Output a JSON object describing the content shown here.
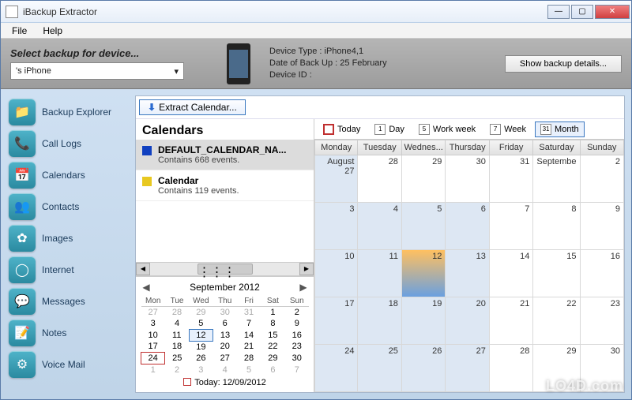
{
  "window": {
    "title": "iBackup Extractor"
  },
  "winbuttons": {
    "min": "—",
    "max": "▢",
    "close": "✕"
  },
  "menu": {
    "file": "File",
    "help": "Help"
  },
  "toolbar": {
    "select_label": "Select backup for device...",
    "dropdown_value": "'s iPhone",
    "device_type_label": "Device Type :",
    "device_type_value": "iPhone4,1",
    "backup_date_label": "Date of Back Up :",
    "backup_date_value": "25 February",
    "device_id_label": "Device ID :",
    "device_id_value": "",
    "show_details": "Show backup details..."
  },
  "sidebar": {
    "items": [
      {
        "label": "Backup Explorer",
        "icon": "📁"
      },
      {
        "label": "Call Logs",
        "icon": "📞"
      },
      {
        "label": "Calendars",
        "icon": "📅"
      },
      {
        "label": "Contacts",
        "icon": "👥"
      },
      {
        "label": "Images",
        "icon": "✿"
      },
      {
        "label": "Internet",
        "icon": "◯"
      },
      {
        "label": "Messages",
        "icon": "💬"
      },
      {
        "label": "Notes",
        "icon": "📝"
      },
      {
        "label": "Voice Mail",
        "icon": "⚙"
      }
    ]
  },
  "extract": {
    "label": "Extract Calendar...",
    "arrow": "⬇"
  },
  "calendars": {
    "heading": "Calendars",
    "list": [
      {
        "name": "DEFAULT_CALENDAR_NA...",
        "sub": "Contains 668 events.",
        "color": "#1040c0",
        "selected": true
      },
      {
        "name": "Calendar",
        "sub": "Contains 119 events.",
        "color": "#e8c820",
        "selected": false
      }
    ]
  },
  "minical": {
    "prev": "◀",
    "next": "▶",
    "title": "September 2012",
    "dow": [
      "Mon",
      "Tue",
      "Wed",
      "Thu",
      "Fri",
      "Sat",
      "Sun"
    ],
    "weeks": [
      [
        {
          "d": "27",
          "o": true
        },
        {
          "d": "28",
          "o": true
        },
        {
          "d": "29",
          "o": true
        },
        {
          "d": "30",
          "o": true
        },
        {
          "d": "31",
          "o": true
        },
        {
          "d": "1"
        },
        {
          "d": "2"
        }
      ],
      [
        {
          "d": "3"
        },
        {
          "d": "4"
        },
        {
          "d": "5"
        },
        {
          "d": "6"
        },
        {
          "d": "7"
        },
        {
          "d": "8"
        },
        {
          "d": "9"
        }
      ],
      [
        {
          "d": "10"
        },
        {
          "d": "11"
        },
        {
          "d": "12",
          "sel": true
        },
        {
          "d": "13"
        },
        {
          "d": "14"
        },
        {
          "d": "15"
        },
        {
          "d": "16"
        }
      ],
      [
        {
          "d": "17"
        },
        {
          "d": "18"
        },
        {
          "d": "19"
        },
        {
          "d": "20"
        },
        {
          "d": "21"
        },
        {
          "d": "22"
        },
        {
          "d": "23"
        }
      ],
      [
        {
          "d": "24",
          "today": true
        },
        {
          "d": "25"
        },
        {
          "d": "26"
        },
        {
          "d": "27"
        },
        {
          "d": "28"
        },
        {
          "d": "29"
        },
        {
          "d": "30"
        }
      ],
      [
        {
          "d": "1",
          "o": true
        },
        {
          "d": "2",
          "o": true
        },
        {
          "d": "3",
          "o": true
        },
        {
          "d": "4",
          "o": true
        },
        {
          "d": "5",
          "o": true
        },
        {
          "d": "6",
          "o": true
        },
        {
          "d": "7",
          "o": true
        }
      ]
    ],
    "today_label": "Today: 12/09/2012"
  },
  "views": {
    "today": "Today",
    "day": "Day",
    "day_n": "1",
    "workweek": "Work week",
    "ww_n": "5",
    "week": "Week",
    "wk_n": "7",
    "month": "Month",
    "mo_n": "31"
  },
  "month": {
    "headers": [
      "Monday",
      "Tuesday",
      "Wednes...",
      "Thursday",
      "Friday",
      "Saturday",
      "Sunday"
    ],
    "rows": [
      [
        "August 27",
        "28",
        "29",
        "30",
        "31",
        "Septembe",
        "2"
      ],
      [
        "3",
        "4",
        "5",
        "6",
        "7",
        "8",
        "9"
      ],
      [
        "10",
        "11",
        "12",
        "13",
        "14",
        "15",
        "16"
      ],
      [
        "17",
        "18",
        "19",
        "20",
        "21",
        "22",
        "23"
      ],
      [
        "24",
        "25",
        "26",
        "27",
        "28",
        "29",
        "30"
      ]
    ],
    "shade_cols_by_row": [
      [
        0
      ],
      [
        0,
        1,
        2,
        3
      ],
      [
        0,
        1,
        2,
        3
      ],
      [
        0,
        1,
        2,
        3
      ],
      [
        0,
        1,
        2,
        3
      ]
    ],
    "highlight": {
      "row": 2,
      "col": 2
    }
  },
  "watermark": "LO4D.com"
}
